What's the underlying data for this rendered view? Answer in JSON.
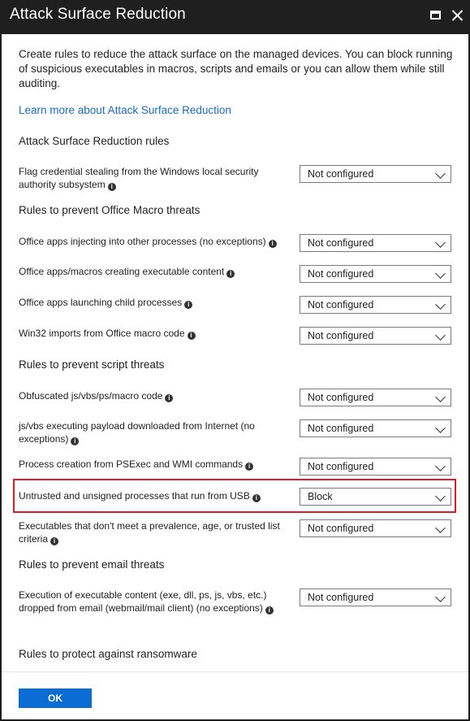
{
  "window": {
    "title": "Attack Surface Reduction"
  },
  "intro": "Create rules to reduce the attack surface on the managed devices. You can block running of suspicious executables in macros, scripts and emails or you can allow them while still auditing.",
  "learn_more": "Learn more about Attack Surface Reduction",
  "sections": {
    "asr": "Attack Surface Reduction rules",
    "macro": "Rules to prevent Office Macro threats",
    "script": "Rules to prevent script threats",
    "email": "Rules to prevent email threats",
    "ransomware": "Rules to protect against ransomware"
  },
  "rules": [
    {
      "label": "Flag credential stealing from the Windows local security authority subsystem",
      "value": "Not configured"
    },
    {
      "label": "Office apps injecting into other processes (no exceptions)",
      "value": "Not configured"
    },
    {
      "label": "Office apps/macros creating executable content",
      "value": "Not configured"
    },
    {
      "label": "Office apps launching child processes",
      "value": "Not configured"
    },
    {
      "label": "Win32 imports from Office macro code",
      "value": "Not configured"
    },
    {
      "label": "Obfuscated js/vbs/ps/macro code",
      "value": "Not configured"
    },
    {
      "label": "js/vbs executing payload downloaded from Internet (no exceptions)",
      "value": "Not configured"
    },
    {
      "label": "Process creation from PSExec and WMI commands",
      "value": "Not configured"
    },
    {
      "label": "Untrusted and unsigned processes that run from USB",
      "value": "Block"
    },
    {
      "label": "Executables that don't meet a prevalence, age, or trusted list criteria",
      "value": "Not configured"
    },
    {
      "label": "Execution of executable content (exe, dll, ps, js, vbs, etc.) dropped from email (webmail/mail client) (no exceptions)",
      "value": "Not configured"
    }
  ],
  "info_glyph": "i",
  "ok_label": "OK",
  "colors": {
    "titlebar": "#1f1f1f",
    "link": "#1b6ac9",
    "highlight": "#d71f2c",
    "primary_button": "#0b6cd3"
  }
}
